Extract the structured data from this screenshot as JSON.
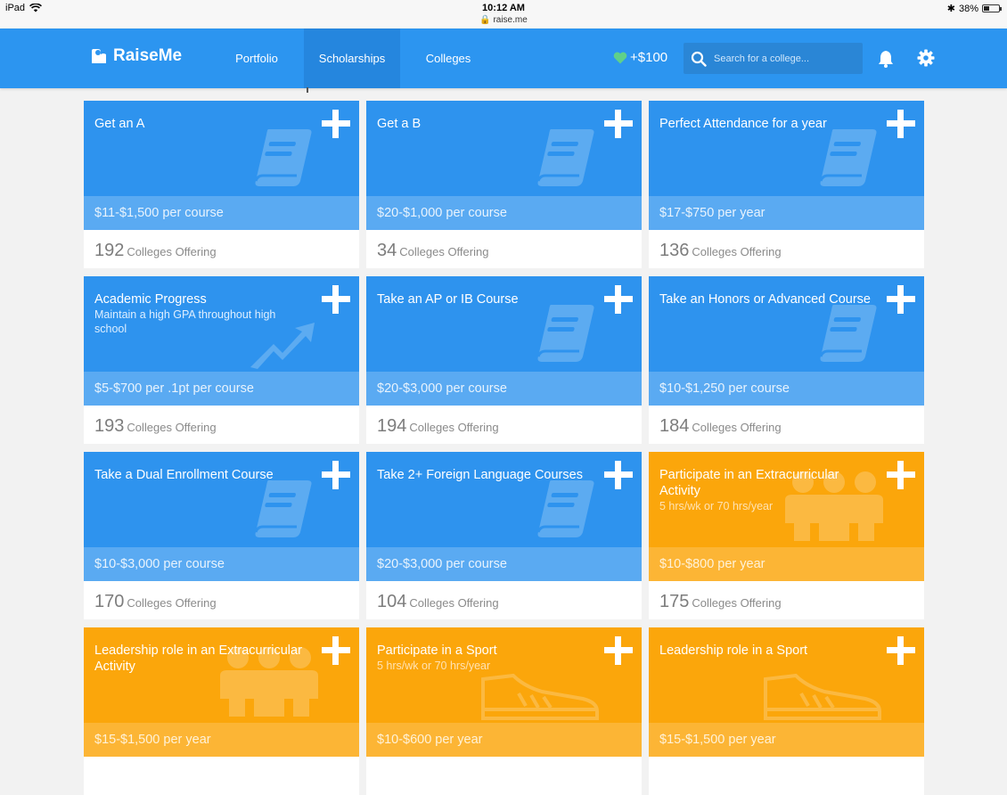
{
  "status_bar": {
    "device": "iPad",
    "time": "10:12 AM",
    "url": "raise.me",
    "battery": "38%",
    "battery_level": 0.38
  },
  "header": {
    "logo_text": "RaiseMe",
    "tabs": [
      {
        "label": "Portfolio",
        "active": false
      },
      {
        "label": "Scholarships",
        "active": true
      },
      {
        "label": "Colleges",
        "active": false
      }
    ],
    "points": "+$100",
    "search_placeholder": "Search for a college..."
  },
  "colors": {
    "brand_blue": "#2c95f0",
    "card_blue": "#2e93ee",
    "card_orange": "#fba60b",
    "heart_green": "#5fd08a"
  },
  "cards": [
    {
      "title": "Get an A",
      "subtitle": "",
      "amount": "$11-$1,500 per course",
      "count": "192",
      "offering": "Colleges Offering",
      "color": "blue",
      "icon": "book-icon"
    },
    {
      "title": "Get a B",
      "subtitle": "",
      "amount": "$20-$1,000 per course",
      "count": "34",
      "offering": "Colleges Offering",
      "color": "blue",
      "icon": "book-icon"
    },
    {
      "title": "Perfect Attendance for a year",
      "subtitle": "",
      "amount": "$17-$750 per year",
      "count": "136",
      "offering": "Colleges Offering",
      "color": "blue",
      "icon": "book-icon"
    },
    {
      "title": "Academic Progress",
      "subtitle": "Maintain a high GPA throughout high school",
      "amount": "$5-$700 per .1pt per course",
      "count": "193",
      "offering": "Colleges Offering",
      "color": "blue",
      "icon": "trend-up-icon"
    },
    {
      "title": "Take an AP or IB Course",
      "subtitle": "",
      "amount": "$20-$3,000 per course",
      "count": "194",
      "offering": "Colleges Offering",
      "color": "blue",
      "icon": "book-icon"
    },
    {
      "title": "Take an Honors or Advanced Course",
      "subtitle": "",
      "amount": "$10-$1,250 per course",
      "count": "184",
      "offering": "Colleges Offering",
      "color": "blue",
      "icon": "book-icon"
    },
    {
      "title": "Take a Dual Enrollment Course",
      "subtitle": "",
      "amount": "$10-$3,000 per course",
      "count": "170",
      "offering": "Colleges Offering",
      "color": "blue",
      "icon": "book-icon"
    },
    {
      "title": "Take 2+ Foreign Language Courses",
      "subtitle": "",
      "amount": "$20-$3,000 per course",
      "count": "104",
      "offering": "Colleges Offering",
      "color": "blue",
      "icon": "book-icon"
    },
    {
      "title": "Participate in an Extracurricular Activity",
      "subtitle": "5 hrs/wk or 70 hrs/year",
      "amount": "$10-$800 per year",
      "count": "175",
      "offering": "Colleges Offering",
      "color": "orange",
      "icon": "group-icon"
    },
    {
      "title": "Leadership role in an Extracurricular Activity",
      "subtitle": "",
      "amount": "$15-$1,500 per year",
      "count": "",
      "offering": "",
      "color": "orange",
      "icon": "group-icon"
    },
    {
      "title": "Participate in a Sport",
      "subtitle": "5 hrs/wk or 70 hrs/year",
      "amount": "$10-$600 per year",
      "count": "",
      "offering": "",
      "color": "orange",
      "icon": "sneaker-icon"
    },
    {
      "title": "Leadership role in a Sport",
      "subtitle": "",
      "amount": "$15-$1,500 per year",
      "count": "",
      "offering": "",
      "color": "orange",
      "icon": "sneaker-icon"
    }
  ]
}
